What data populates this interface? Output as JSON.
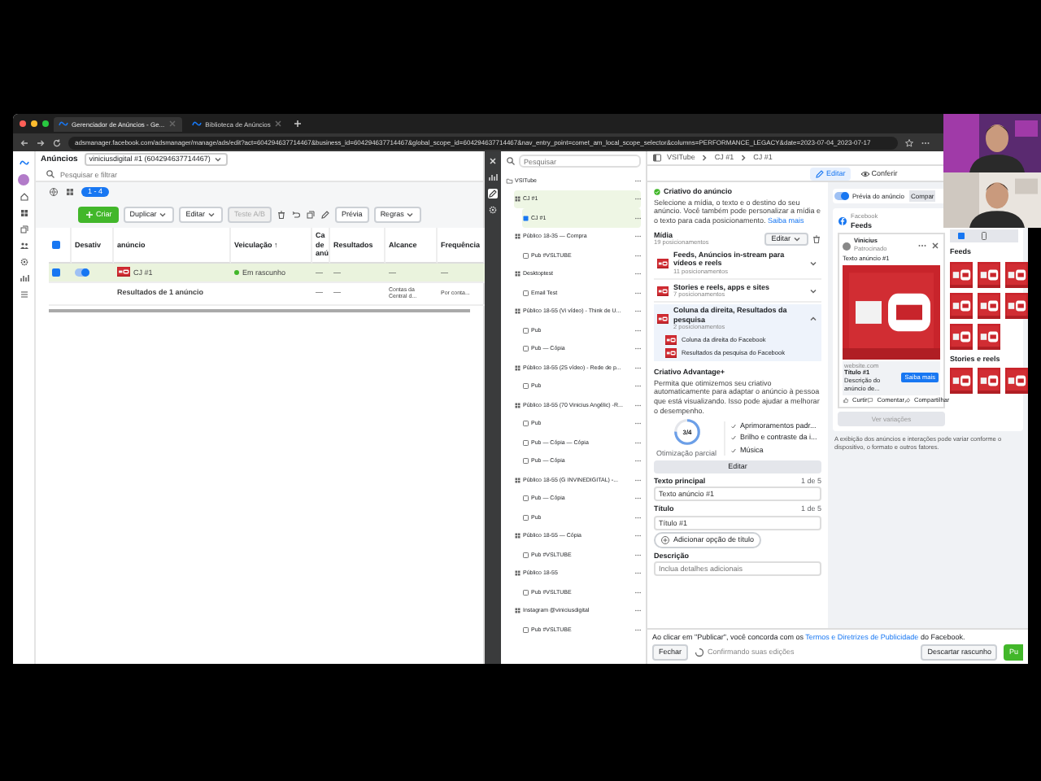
{
  "browser": {
    "tabs": [
      {
        "label": "Gerenciador de Anúncios - Ge...",
        "selected": true
      },
      {
        "label": "Biblioteca de Anúncios",
        "selected": false
      }
    ],
    "url": "adsmanager.facebook.com/adsmanager/manage/ads/edit?act=604294637714467&business_id=604294637714467&global_scope_id=604294637714467&nav_entry_point=comet_am_local_scope_selector&columns=PERFORMANCE_LEGACY&date=2023-07-04_2023-07-17"
  },
  "ads_manager": {
    "title": "Anúncios",
    "account": "viniciusdigital #1 (604294637714467)",
    "search": {
      "placeholder": "Pesquisar e filtrar"
    },
    "view_badge": "1 - 4",
    "all_checked": true,
    "toolbar": [
      {
        "label": "Criar",
        "kind": "primary",
        "disabled": false
      },
      {
        "label": "Duplicar",
        "kind": "menu",
        "disabled": false
      },
      {
        "label": "Editar",
        "kind": "menu",
        "disabled": false
      },
      {
        "label": "Teste A/B",
        "kind": "plain",
        "disabled": true
      },
      {
        "label": "Prévia",
        "kind": "plain",
        "disabled": false
      },
      {
        "label": "Regras",
        "kind": "menu",
        "disabled": false
      }
    ],
    "columns": [
      "Desativ",
      "anúncio",
      "Veiculação ↑",
      "Ca de anú",
      "Resultados",
      "Alcance",
      "Frequência"
    ],
    "rows": [
      {
        "checked": true,
        "on": true,
        "cells": [
          "",
          "CJ #1",
          "Em rascunho",
          "—",
          "—",
          "—",
          "—"
        ]
      }
    ],
    "summary": {
      "cells": [
        "",
        "Resultados de 1 anúncio",
        "",
        "—",
        "—",
        "Contas da Central d...",
        "Por conta..."
      ]
    }
  },
  "tree": {
    "search": {
      "placeholder": "Pesquisar"
    },
    "items": [
      {
        "kind": "campaign",
        "label": "VSITube",
        "selected": false,
        "children": [
          {
            "kind": "adset",
            "label": "CJ #1",
            "selected": true,
            "children": [
              {
                "kind": "ad",
                "label": "CJ #1",
                "selected": true
              }
            ]
          },
          {
            "kind": "adset",
            "label": "Público 18-35 — Compra",
            "selected": false,
            "children": [
              {
                "kind": "ad",
                "label": "Pub #VSLTUBE",
                "selected": false
              }
            ]
          },
          {
            "kind": "adset",
            "label": "Desktoptest",
            "selected": false,
            "children": [
              {
                "kind": "ad",
                "label": "Email Test",
                "selected": false
              }
            ]
          },
          {
            "kind": "adset",
            "label": "Público 18-55 (Vi vídeo) - Think de U...",
            "selected": false,
            "children": [
              {
                "kind": "ad",
                "label": "Pub",
                "selected": false
              },
              {
                "kind": "ad",
                "label": "Pub — Cópia",
                "selected": false
              }
            ]
          },
          {
            "kind": "adset",
            "label": "Público 18-55 (25 vídeo) - Rede de p...",
            "selected": false,
            "children": [
              {
                "kind": "ad",
                "label": "Pub",
                "selected": false
              }
            ]
          },
          {
            "kind": "adset",
            "label": "Público 18-55 (70 Vinicius Angélic) -R...",
            "selected": false,
            "children": [
              {
                "kind": "ad",
                "label": "Pub",
                "selected": false
              },
              {
                "kind": "ad",
                "label": "Pub — Cópia — Cópia",
                "selected": false
              },
              {
                "kind": "ad",
                "label": "Pub — Cópia",
                "selected": false
              }
            ]
          },
          {
            "kind": "adset",
            "label": "Público 18-55 (G INVINEDIGITAL) -...",
            "selected": false,
            "children": [
              {
                "kind": "ad",
                "label": "Pub — Cópia",
                "selected": false
              },
              {
                "kind": "ad",
                "label": "Pub",
                "selected": false
              }
            ]
          },
          {
            "kind": "adset",
            "label": "Público 18-55 — Cópia",
            "selected": false,
            "children": [
              {
                "kind": "ad",
                "label": "Pub #VSLTUBE",
                "selected": false
              }
            ]
          },
          {
            "kind": "adset",
            "label": "Público 18-55",
            "selected": false,
            "children": [
              {
                "kind": "ad",
                "label": "Pub #VSLTUBE",
                "selected": false
              }
            ]
          },
          {
            "kind": "adset",
            "label": "Instagram @viniciusdigital",
            "selected": false,
            "children": [
              {
                "kind": "ad",
                "label": "Pub #VSLTUBE",
                "selected": false
              }
            ]
          }
        ]
      }
    ]
  },
  "breadcrumb": [
    "VSITube",
    "CJ #1",
    "CJ #1"
  ],
  "mode_buttons": [
    {
      "label": "Editar",
      "selected": true
    },
    {
      "label": "Conferir",
      "selected": false
    }
  ],
  "editor": {
    "title": "Criativo do anúncio",
    "intro": "Selecione a mídia, o texto e o destino do seu anúncio. Você também pode personalizar a mídia e o texto para cada posicionamento.",
    "intro_link": "Saiba mais",
    "media": {
      "label": "Mídia",
      "count": "19 posicionamentos",
      "edit": "Editar",
      "groups": [
        {
          "title": "Feeds, Anúncios in-stream para vídeos e reels",
          "count": "11 posicionamentos",
          "expanded": false
        },
        {
          "title": "Stories e reels, apps e sites",
          "count": "7 posicionamentos",
          "expanded": false
        },
        {
          "title": "Coluna da direita, Resultados da pesquisa",
          "count": "2 posicionamentos",
          "expanded": true,
          "items": [
            "Coluna da direita do Facebook",
            "Resultados da pesquisa do Facebook"
          ]
        }
      ]
    },
    "advantage": {
      "title": "Criativo Advantage+",
      "text": "Permita que otimizemos seu criativo automaticamente para adaptar o anúncio à pessoa que está visualizando. Isso pode ajudar a melhorar o desempenho.",
      "score": "3/4",
      "level": 0.75,
      "score_label": "Otimização parcial",
      "options": [
        {
          "label": "Aprimoramentos padr...",
          "checked": true
        },
        {
          "label": "Brilho e contraste da i...",
          "checked": true
        },
        {
          "label": "Música",
          "checked": true
        }
      ],
      "edit": "Editar"
    },
    "primary_text": {
      "label": "Texto principal",
      "counter": "1 de 5",
      "value": "Texto anúncio #1"
    },
    "headline": {
      "label": "Título",
      "counter": "1 de 5",
      "value": "Título #1"
    },
    "add_headline": "Adicionar opção de título",
    "description": {
      "label": "Descrição",
      "placeholder": "Inclua detalhes adicionais"
    }
  },
  "preview": {
    "toggle": {
      "label": "Prévia do anúncio",
      "on": true
    },
    "share": "Compar",
    "platform": "Facebook",
    "placement": "Feeds",
    "post": {
      "page": "Vinicius",
      "sponsored": "Patrocinado",
      "text": "Texto anúncio #1",
      "site": "website.com",
      "headline": "Título #1",
      "description": "Descrição do anúncio de...",
      "cta": "Saiba mais",
      "actions": [
        "Curtir",
        "Comentar",
        "Compartilhar"
      ]
    },
    "variations": "Ver variações",
    "sections": [
      {
        "title": "Feeds"
      },
      {
        "title": "Stories e reels"
      }
    ],
    "note": "A exibição dos anúncios e interações pode variar conforme o dispositivo, o formato e outros fatores."
  },
  "footer": {
    "terms_before": "Ao clicar em \"Publicar\", você concorda com os",
    "terms_link": "Termos e Diretrizes de Publicidade",
    "terms_after": "do Facebook.",
    "close": "Fechar",
    "status": "Confirmando suas edições",
    "discard": "Descartar rascunho",
    "publish": "Pu"
  }
}
